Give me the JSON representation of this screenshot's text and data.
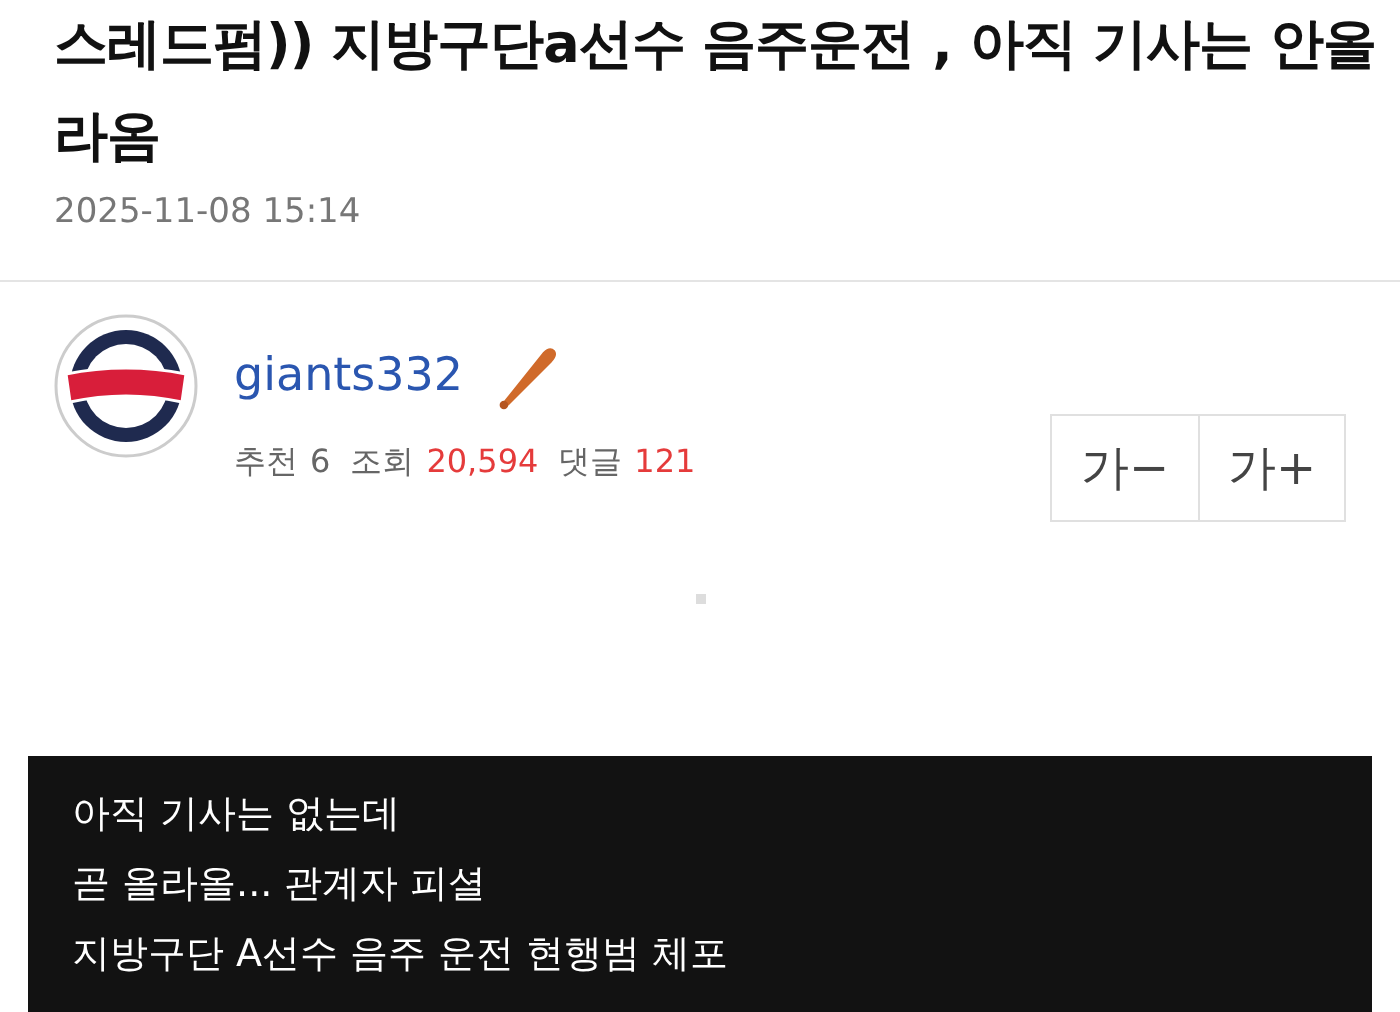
{
  "post": {
    "title": "스레드펌)) 지방구단a선수 음주운전 , 아직 기사는 안올라옴",
    "date": "2025-11-08 15:14"
  },
  "author": {
    "name": "giants332",
    "stats": [
      {
        "label": "추천",
        "value": "6",
        "highlight": false
      },
      {
        "label": "조회",
        "value": "20,594",
        "highlight": true
      },
      {
        "label": "댓글",
        "value": "121",
        "highlight": true
      }
    ]
  },
  "font_buttons": [
    "가−",
    "가+"
  ],
  "body_lines": [
    "아직 기사는 없는데",
    "곧 올라올... 관계자 피셜",
    "지방구단 A선수 음주 운전 현행범 체포"
  ]
}
